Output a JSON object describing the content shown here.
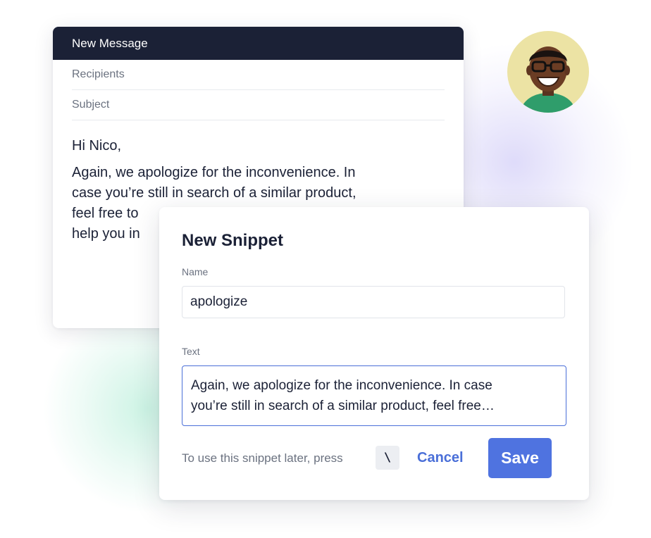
{
  "compose": {
    "title": "New Message",
    "recipients_placeholder": "Recipients",
    "subject_placeholder": "Subject",
    "greeting": "Hi Nico,",
    "body_lines": [
      "Again, we apologize for the inconvenience. In",
      "case you’re still in search of a similar product,",
      "feel free to",
      "help you in"
    ]
  },
  "avatar": {
    "icon": "user-avatar-photo",
    "background_color": "#ece3a4"
  },
  "snippet": {
    "title": "New Snippet",
    "name_label": "Name",
    "name_value": "apologize",
    "text_label": "Text",
    "text_value": "Again, we apologize for the inconvenience. In case\nyou’re still in search of a similar product, feel free…",
    "hint": "To use this snippet later, press",
    "shortcut_key": "\\",
    "cancel_label": "Cancel",
    "save_label": "Save"
  },
  "colors": {
    "header_bg": "#1b2136",
    "accent": "#4f73e0",
    "link": "#4a6fd8"
  }
}
